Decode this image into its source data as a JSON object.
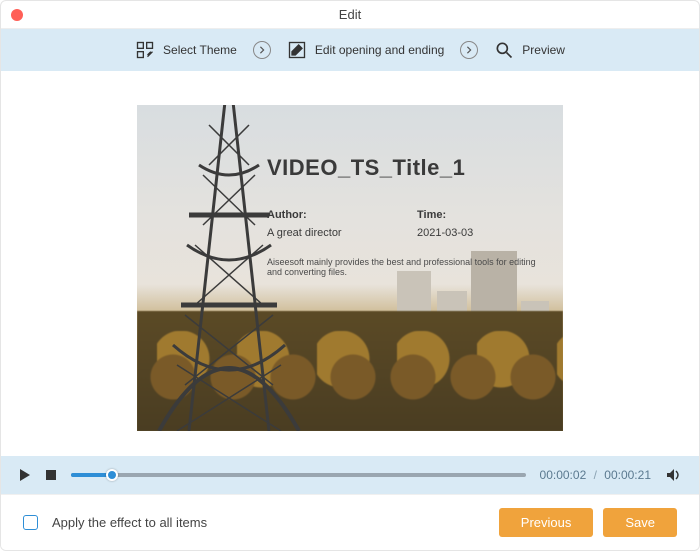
{
  "window": {
    "title": "Edit"
  },
  "steps": {
    "theme": "Select Theme",
    "edit": "Edit opening and ending",
    "preview": "Preview"
  },
  "preview": {
    "title": "VIDEO_TS_Title_1",
    "author_label": "Author:",
    "author_value": "A great director",
    "time_label": "Time:",
    "time_value": "2021-03-03",
    "description": "Aiseesoft mainly provides the best and professional tools for editing and converting files."
  },
  "player": {
    "current": "00:00:02",
    "separator": "/",
    "total": "00:00:21"
  },
  "footer": {
    "checkbox_label": "Apply the effect to all items",
    "previous": "Previous",
    "save": "Save"
  }
}
